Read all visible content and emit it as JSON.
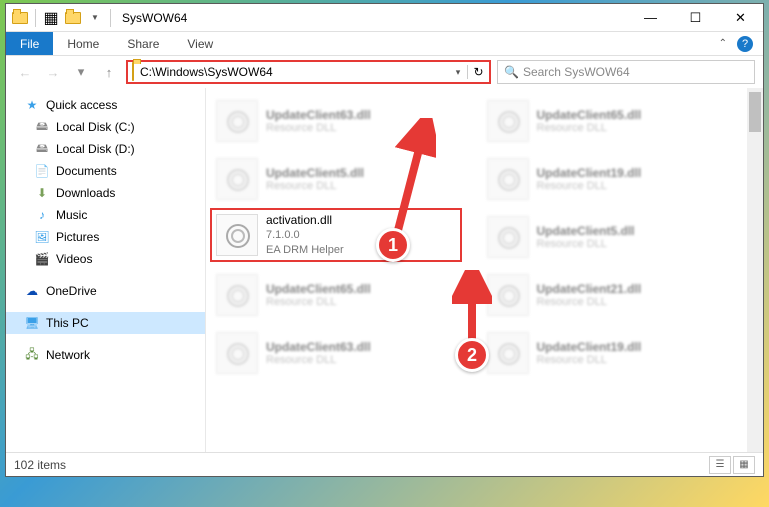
{
  "window": {
    "title": "SysWOW64",
    "minimize": "—",
    "maximize": "☐",
    "close": "✕"
  },
  "ribbon": {
    "file": "File",
    "home": "Home",
    "share": "Share",
    "view": "View"
  },
  "address": {
    "path": "C:\\Windows\\SysWOW64",
    "dropdown": "▾",
    "refresh": "↻"
  },
  "search": {
    "placeholder": "Search SysWOW64"
  },
  "nav": {
    "quick": "Quick access",
    "diskC": "Local Disk (C:)",
    "diskD": "Local Disk (D:)",
    "docs": "Documents",
    "downloads": "Downloads",
    "music": "Music",
    "pictures": "Pictures",
    "videos": "Videos",
    "onedrive": "OneDrive",
    "thispc": "This PC",
    "network": "Network"
  },
  "highlight": {
    "name": "activation.dll",
    "version": "7.1.0.0",
    "desc": "EA DRM Helper"
  },
  "bgfiles": [
    {
      "n": "UpdateClient63.dll",
      "s": "Resource DLL"
    },
    {
      "n": "UpdateClient65.dll",
      "s": "Resource DLL"
    },
    {
      "n": "UpdateClient5.dll",
      "s": "Resource DLL"
    },
    {
      "n": "UpdateClient19.dll",
      "s": "Resource DLL"
    },
    {
      "n": "",
      "s": ""
    },
    {
      "n": "UpdateClient5.dll",
      "s": "Resource DLL"
    },
    {
      "n": "UpdateClient65.dll",
      "s": "Resource DLL"
    },
    {
      "n": "UpdateClient21.dll",
      "s": "Resource DLL"
    },
    {
      "n": "UpdateClient63.dll",
      "s": "Resource DLL"
    },
    {
      "n": "UpdateClient19.dll",
      "s": "Resource DLL"
    }
  ],
  "annotations": {
    "one": "1",
    "two": "2"
  },
  "status": {
    "count": "102 items"
  }
}
